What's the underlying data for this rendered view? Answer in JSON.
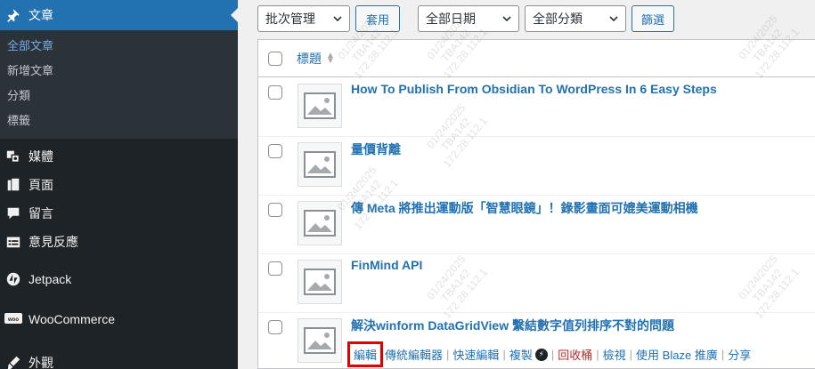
{
  "sidebar": {
    "current_menu": {
      "label": "文章",
      "icon": "pushpin-icon"
    },
    "submenu": [
      {
        "label": "全部文章",
        "current": true
      },
      {
        "label": "新增文章",
        "current": false
      },
      {
        "label": "分類",
        "current": false
      },
      {
        "label": "標籤",
        "current": false
      }
    ],
    "items": [
      {
        "label": "媒體",
        "icon": "media-icon"
      },
      {
        "label": "頁面",
        "icon": "pages-icon"
      },
      {
        "label": "留言",
        "icon": "comments-icon"
      },
      {
        "label": "意見反應",
        "icon": "feedback-icon"
      },
      {
        "label": "Jetpack",
        "icon": "jetpack-icon"
      },
      {
        "label": "WooCommerce",
        "icon": "woocommerce-icon"
      },
      {
        "label": "外觀",
        "icon": "appearance-icon"
      }
    ]
  },
  "toolbar": {
    "bulk_actions": "批次管理",
    "apply": "套用",
    "date_filter": "全部日期",
    "category_filter": "全部分類",
    "filter": "篩選"
  },
  "table": {
    "header_title": "標題",
    "rows": [
      {
        "title": "How To Publish From Obsidian To WordPress In 6 Easy Steps"
      },
      {
        "title": "量價背離"
      },
      {
        "title": "傳 Meta 將推出運動版「智慧眼鏡」！錄影畫面可媲美運動相機"
      },
      {
        "title": "FinMind API"
      },
      {
        "title": "解決winform DataGridView 繫結數字值列排序不對的問題"
      }
    ],
    "row_actions": {
      "edit": "編輯",
      "classic_editor": "傳統編輯器",
      "quick_edit": "快速編輯",
      "duplicate": "複製",
      "trash": "回收桶",
      "view": "檢視",
      "blaze": "使用 Blaze 推廣",
      "share": "分享"
    }
  },
  "watermark": {
    "line1": "01/24/2025",
    "line2": "TBA142",
    "line3": "172.28.112.1"
  },
  "colors": {
    "sidebar_bg": "#1d2327",
    "accent": "#2271b1",
    "highlight": "#e00000",
    "trash": "#b32d2e"
  }
}
